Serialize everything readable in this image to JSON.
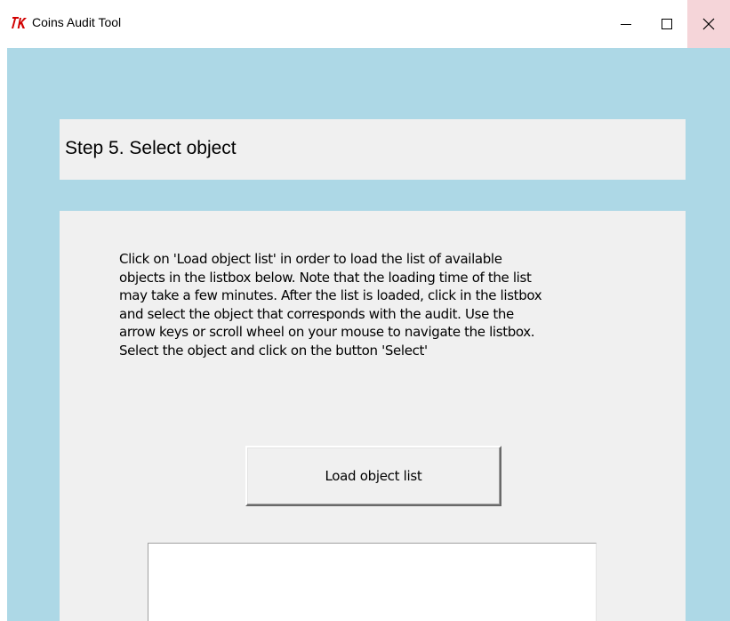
{
  "window": {
    "title": "Coins Audit Tool",
    "icon": "tk-feather-icon",
    "controls": {
      "minimize_icon": "minimize-icon",
      "maximize_icon": "maximize-icon",
      "close_icon": "close-icon"
    }
  },
  "colors": {
    "background": "#add8e6",
    "panel": "#f0f0f0",
    "icon_red": "#d10000"
  },
  "step": {
    "title": "Step 5. Select object"
  },
  "content": {
    "instructions": "Click on 'Load object list' in order to load the list of available\nobjects in the listbox below. Note that the loading time of the list\nmay take a few minutes. After the list is loaded, click in the listbox\nand select the object that corresponds with the audit. Use the\narrow keys or scroll wheel on your mouse to navigate the listbox.\nSelect the object and click on the button 'Select'",
    "load_button_label": "Load object list",
    "listbox_items": []
  }
}
